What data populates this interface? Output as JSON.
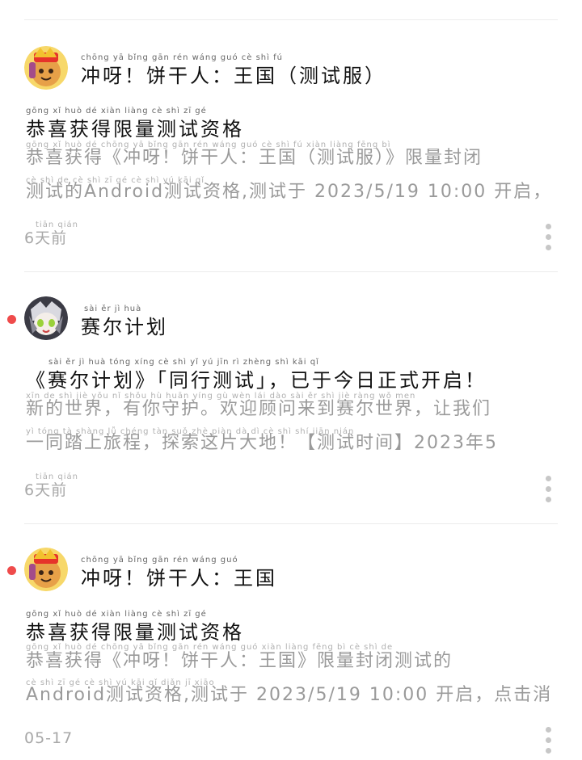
{
  "feed": [
    {
      "app_name": "冲呀！饼干人：王国（测试服）",
      "app_pinyin": "chōng yā     bǐng gān rén     wáng guó     cè shì fú",
      "title": "恭喜获得限量测试资格",
      "title_pinyin": "gōng xǐ huò dé xiàn liàng cè shì zī gé",
      "desc_line1": "恭喜获得《冲呀！饼干人：王国（测试服）》限量封闭",
      "desc_line2": "测试的Android测试资格,测试于 2023/5/19 10:00 开启，…",
      "desc_pinyin1": "gōng xǐ huò dé    chōng yā    bǐng gān rén    wáng guó    cè shì fú        xiàn liàng fēng bì",
      "desc_pinyin2": "cè shì de                    cè shì zī gé   cè shì yú                                          kāi qǐ",
      "time": "6天前",
      "time_pinyin": "tiān qián",
      "unread": false
    },
    {
      "app_name": "赛尔计划",
      "app_pinyin": "sài ěr jì huà",
      "title": "《赛尔计划》「同行测试」，已于今日正式开启！",
      "title_pinyin": "sài ěr jì huà        tóng xíng cè shì        yǐ yú jīn rì zhèng shì kāi qǐ",
      "desc_line1": "新的世界，有你守护。欢迎顾问来到赛尔世界，让我们",
      "desc_line2": "一同踏上旅程，探索这片大地！【测试时间】2023年5",
      "desc_pinyin1": "xīn de shì jiè    yǒu nǐ shǒu hù    huān yíng gù wèn lái dào sài ěr shì jiè    ràng wǒ men",
      "desc_pinyin2": "yì tóng tà shàng lǚ chéng    tàn suǒ zhè piàn dà dì        cè shì shí jiān          nián",
      "time": "6天前",
      "time_pinyin": "tiān qián",
      "unread": true
    },
    {
      "app_name": "冲呀！饼干人：王国",
      "app_pinyin": "chōng yā     bǐng gān rén     wáng guó",
      "title": "恭喜获得限量测试资格",
      "title_pinyin": "gōng xǐ huò dé xiàn liàng cè shì zī gé",
      "desc_line1": "恭喜获得《冲呀！饼干人：王国》限量封闭测试的",
      "desc_line2": "Android测试资格,测试于 2023/5/19 10:00 开启，点击消…",
      "desc_pinyin1": "gōng xǐ huò dé    chōng yā    bǐng gān rén    wáng guó    xiàn liàng fēng bì cè shì de",
      "desc_pinyin2": "                 cè shì zī gé   cè shì yú                           kāi qǐ        diǎn jī xiāo",
      "time": "05-17",
      "time_pinyin": "",
      "unread": true
    }
  ],
  "icons": {
    "more": "more-vertical-icon",
    "unread": "unread-dot-icon",
    "avatar_cookie": "cookie-run-kingdom-icon",
    "avatar_seer": "seer-plan-icon"
  },
  "colors": {
    "unread_dot": "#ef4b4b",
    "secondary_text": "#9a9a9a"
  }
}
